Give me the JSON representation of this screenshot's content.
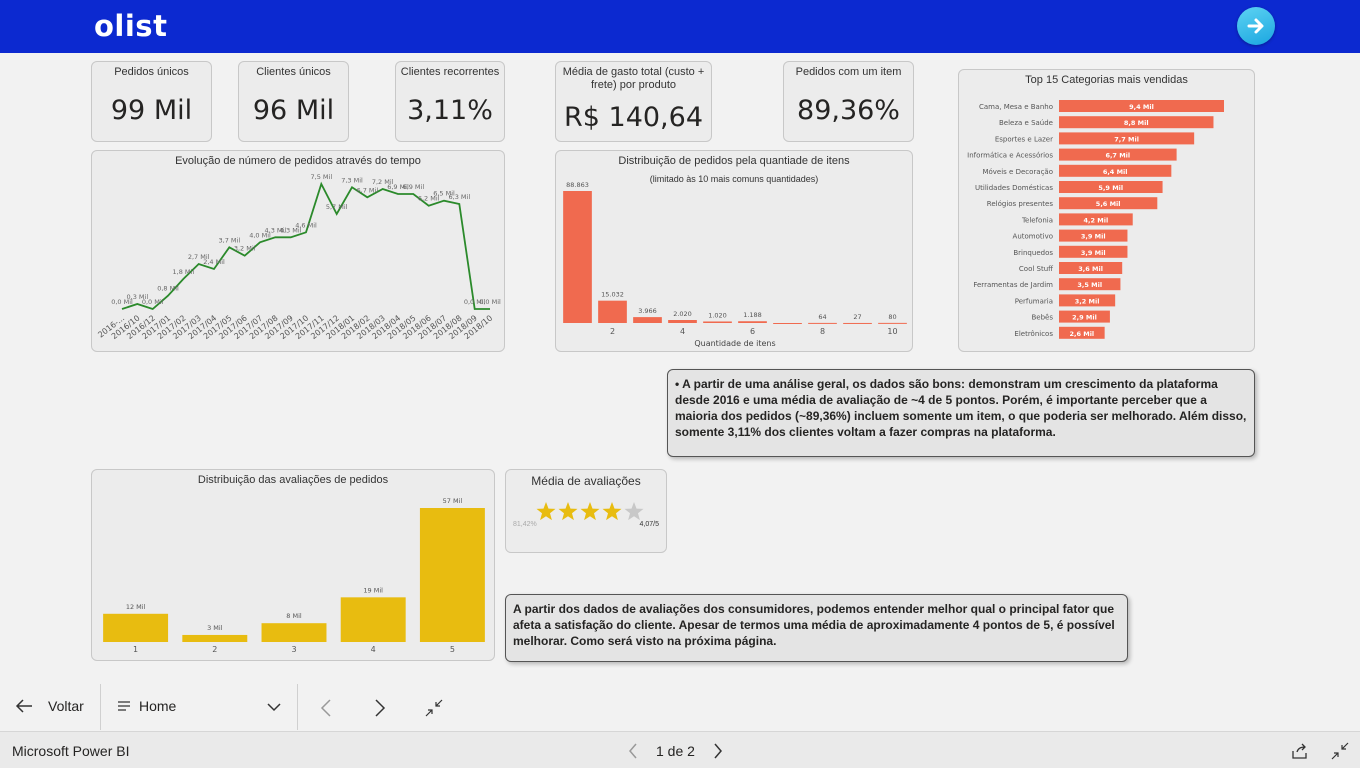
{
  "header": {
    "logo": "olist",
    "next_page_icon": "arrow-right-icon"
  },
  "kpis": [
    {
      "label": "Pedidos únicos",
      "value": "99 Mil"
    },
    {
      "label": "Clientes únicos",
      "value": "96 Mil"
    },
    {
      "label": "Clientes recorrentes",
      "value": "3,11%"
    },
    {
      "label": "Média de gasto total (custo + frete) por produto",
      "value": "R$ 140,64"
    },
    {
      "label": "Pedidos com um item",
      "value": "89,36%"
    }
  ],
  "line_chart": {
    "title": "Evolução de número de pedidos através do tempo",
    "chart_data": {
      "type": "line",
      "series_color": "#2b8a2b",
      "x": [
        "2016-...",
        "2016/10",
        "2016/12",
        "2017/01",
        "2017/02",
        "2017/03",
        "2017/04",
        "2017/05",
        "2017/06",
        "2017/07",
        "2017/08",
        "2017/09",
        "2017/10",
        "2017/11",
        "2017/12",
        "2018/01",
        "2018/02",
        "2018/03",
        "2018/04",
        "2018/05",
        "2018/06",
        "2018/07",
        "2018/08",
        "2018/09",
        "2018/10"
      ],
      "values": [
        0.0,
        0.3,
        0.0,
        0.8,
        1.8,
        2.7,
        2.4,
        3.7,
        3.2,
        4.0,
        4.3,
        4.3,
        4.6,
        7.5,
        5.7,
        7.3,
        6.7,
        7.2,
        6.9,
        6.9,
        6.2,
        6.5,
        6.3,
        0.0,
        0.0
      ],
      "labels": [
        "0,0 Mil",
        "0,3 Mil",
        "0,0 Mil",
        "0,8 Mil",
        "1,8 Mil",
        "2,7 Mil",
        "2,4 Mil",
        "3,7 Mil",
        "3,2 Mil",
        "4,0 Mil",
        "4,3 Mil",
        "4,3 Mil",
        "4,6 Mil",
        "7,5 Mil",
        "5,7 Mil",
        "7,3 Mil",
        "6,7 Mil",
        "7,2 Mil",
        "6,9 Mil",
        "6,9 Mil",
        "6,2 Mil",
        "6,5 Mil",
        "6,3 Mil",
        "0,0 Mil",
        "0,0 Mil"
      ],
      "ylim": [
        0,
        7.5
      ]
    }
  },
  "items_chart": {
    "title": "Distribuição de pedidos pela quantiade de itens",
    "subtitle": "(limitado às 10 mais comuns quantidades)",
    "chart_data": {
      "type": "bar",
      "color": "#f06a4f",
      "categories": [
        "1",
        "2",
        "3",
        "4",
        "5",
        "6",
        "7",
        "8",
        "9",
        "10"
      ],
      "values": [
        88863,
        15032,
        3966,
        2020,
        1020,
        1188,
        0,
        64,
        27,
        80
      ],
      "labels": [
        "88.863",
        "15.032",
        "3.966",
        "2.020",
        "1.020",
        "1.188",
        "",
        "64",
        "27",
        "80"
      ],
      "tick_labels": [
        "",
        "2",
        "",
        "4",
        "",
        "6",
        "",
        "8",
        "",
        "10"
      ],
      "xlabel": "Quantidade de itens",
      "ylim": [
        0,
        88863
      ]
    }
  },
  "category_chart": {
    "title": "Top 15 Categorias mais vendidas",
    "chart_data": {
      "type": "bar",
      "orientation": "horizontal",
      "color": "#f06a4f",
      "categories": [
        "Cama, Mesa e Banho",
        "Beleza e Saúde",
        "Esportes e Lazer",
        "Informática e Acessórios",
        "Móveis e Decoração",
        "Utilidades Domésticas",
        "Relógios presentes",
        "Telefonia",
        "Automotivo",
        "Brinquedos",
        "Cool Stuff",
        "Ferramentas de Jardim",
        "Perfumaria",
        "Bebês",
        "Eletrônicos"
      ],
      "values": [
        9.4,
        8.8,
        7.7,
        6.7,
        6.4,
        5.9,
        5.6,
        4.2,
        3.9,
        3.9,
        3.6,
        3.5,
        3.2,
        2.9,
        2.6
      ],
      "labels": [
        "9,4 Mil",
        "8,8 Mil",
        "7,7 Mil",
        "6,7 Mil",
        "6,4 Mil",
        "5,9 Mil",
        "5,6 Mil",
        "4,2 Mil",
        "3,9 Mil",
        "3,9 Mil",
        "3,6 Mil",
        "3,5 Mil",
        "3,2 Mil",
        "2,9 Mil",
        "2,6 Mil"
      ],
      "xlim": [
        0,
        9.4
      ]
    }
  },
  "note_top": "• A partir de uma análise geral, os dados são bons: demonstram um crescimento da plataforma desde 2016 e uma média de avaliação de ~4 de 5 pontos. Porém, é importante perceber que a maioria dos pedidos (~89,36%) incluem somente um item, o que poderia ser melhorado. Além disso, somente 3,11% dos clientes voltam a fazer compras na plataforma.",
  "ratings_chart": {
    "title": "Distribuição das avaliações de pedidos",
    "chart_data": {
      "type": "bar",
      "color": "#e8bc10",
      "categories": [
        "1",
        "2",
        "3",
        "4",
        "5"
      ],
      "values": [
        12,
        3,
        8,
        19,
        57
      ],
      "labels": [
        "12 Mil",
        "3 Mil",
        "8 Mil",
        "19 Mil",
        "57 Mil"
      ],
      "ylim": [
        0,
        57
      ]
    }
  },
  "avg_rating": {
    "title": "Média de avaliações",
    "percent": "81,42%",
    "value_text": "4,07/5",
    "stars_filled": 4,
    "stars_total": 5,
    "star_color": "#e8bc10",
    "empty_star_color": "#c8c8c8"
  },
  "note_bottom": "A partir dos dados de avaliações dos consumidores, podemos entender melhor qual o principal fator que afeta a satisfação do cliente. Apesar de termos uma média de aproximadamente 4 pontos de 5, é possível melhorar. Como será visto na próxima página.",
  "nav": {
    "back_label": "Voltar",
    "page_select": "Home",
    "prev_icon": "chevron-left-icon",
    "next_icon": "chevron-right-icon",
    "collapse_icon": "collapse-icon"
  },
  "status": {
    "app_title": "Microsoft Power BI",
    "pager": "1 de 2",
    "share_icon": "share-icon",
    "exit_fullscreen_icon": "exit-fullscreen-icon"
  }
}
